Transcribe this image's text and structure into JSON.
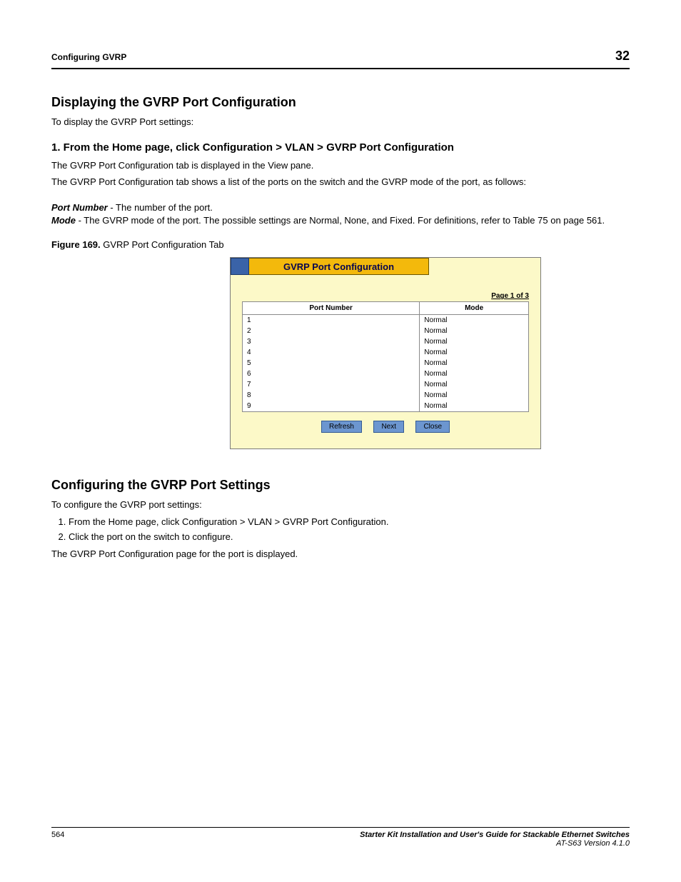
{
  "header": {
    "left": "Configuring GVRP",
    "right": "32"
  },
  "section": {
    "title": "Displaying the GVRP Port Configuration",
    "intro_lead": "To display the GVRP Port settings:",
    "step1_heading": "1. From the Home page, click Configuration > VLAN > GVRP Port Configuration",
    "step1_p1": "The GVRP Port Configuration tab is displayed in the View pane.",
    "step1_p2": "The GVRP Port Configuration tab shows a list of the ports on the switch and the GVRP mode of the port, as follows:",
    "terms": [
      {
        "label": "Port Number",
        "desc": " - The number of the port."
      },
      {
        "label": "Mode",
        "desc": " - The GVRP mode of the port. The possible settings are Normal, None, and Fixed. For definitions, refer to Table 75 on page 561."
      }
    ],
    "fig_prefix": "Figure 169.",
    "fig_title": " GVRP Port Configuration Tab"
  },
  "panel": {
    "title": "GVRP Port Configuration",
    "pager": "Page 1 of 3",
    "columns": [
      "Port Number",
      "Mode"
    ],
    "rows": [
      {
        "port": "1",
        "mode": "Normal"
      },
      {
        "port": "2",
        "mode": "Normal"
      },
      {
        "port": "3",
        "mode": "Normal"
      },
      {
        "port": "4",
        "mode": "Normal"
      },
      {
        "port": "5",
        "mode": "Normal"
      },
      {
        "port": "6",
        "mode": "Normal"
      },
      {
        "port": "7",
        "mode": "Normal"
      },
      {
        "port": "8",
        "mode": "Normal"
      },
      {
        "port": "9",
        "mode": "Normal"
      }
    ],
    "buttons": {
      "refresh": "Refresh",
      "next": "Next",
      "close": "Close"
    }
  },
  "more": {
    "title": "Configuring the GVRP Port Settings",
    "intro_lead": "To configure the GVRP port settings:",
    "steps": [
      "From the Home page, click Configuration > VLAN > GVRP Port Configuration.",
      "Click the port on the switch to configure."
    ],
    "after": "The GVRP Port Configuration page for the port is displayed."
  },
  "footer": {
    "page": "564",
    "title": "Starter Kit Installation and User's Guide for Stackable Ethernet Switches",
    "model": "AT-S63 Version 4.1.0"
  }
}
